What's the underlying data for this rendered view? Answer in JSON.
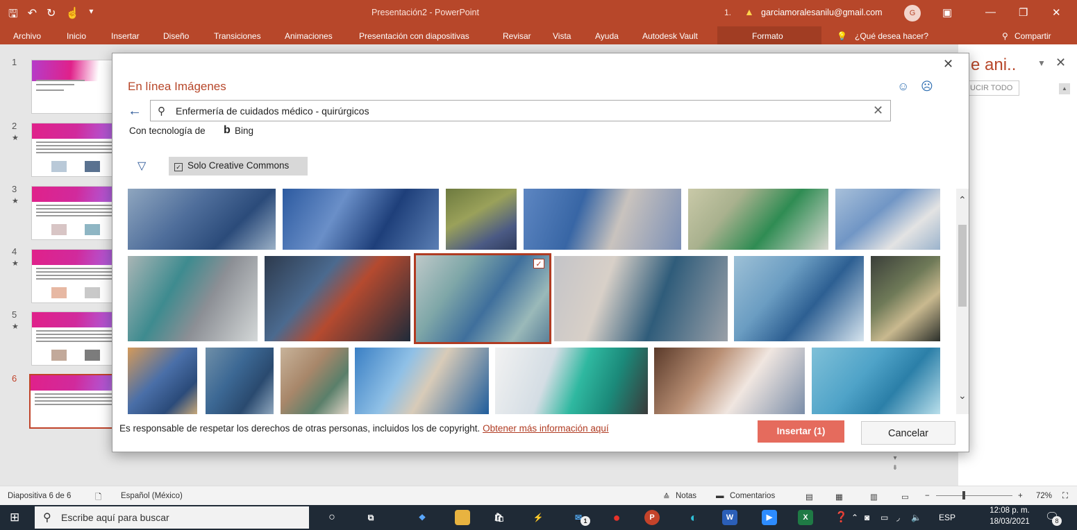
{
  "window": {
    "title": "Presentación2  -  PowerPoint",
    "account": "garciamoralesanilu@gmail.com",
    "avatar_letter": "G",
    "warn_icon": "warning-icon",
    "ctx_num": "1."
  },
  "menu": {
    "tabs": [
      "Archivo",
      "Inicio",
      "Insertar",
      "Diseño",
      "Transiciones",
      "Animaciones",
      "Presentación con diapositivas",
      "Revisar",
      "Vista",
      "Ayuda",
      "Autodesk Vault",
      "Formato"
    ],
    "tellme": "¿Qué desea hacer?",
    "share": "Compartir"
  },
  "thumbs": {
    "numbers": [
      "1",
      "2",
      "3",
      "4",
      "5",
      "6"
    ],
    "star": "★",
    "selected_index": 6
  },
  "rightpane": {
    "title": "e ani..",
    "button": "UCIR TODO"
  },
  "dialog": {
    "title": "En línea Imágenes",
    "search_value": "Enfermería de cuidados médico - quirúrgicos",
    "powered": "Con tecnología de",
    "bing": "Bing",
    "filter_label": "Solo Creative Commons",
    "legal_text": "Es responsable de respetar los derechos de otras personas, incluidos los de copyright.",
    "legal_link": "Obtener más información aquí",
    "insert": "Insertar (1)",
    "cancel": "Cancelar",
    "selected_image": 9
  },
  "status": {
    "slide": "Diapositiva 6 de 6",
    "language": "Español (México)",
    "notes": "Notas",
    "comments": "Comentarios",
    "zoom": "72%"
  },
  "taskbar": {
    "search_placeholder": "Escribe aquí para buscar",
    "lang": "ESP",
    "time": "12:08 p. m.",
    "date": "18/03/2021",
    "notif_count": "8",
    "mail_badge": "1"
  }
}
